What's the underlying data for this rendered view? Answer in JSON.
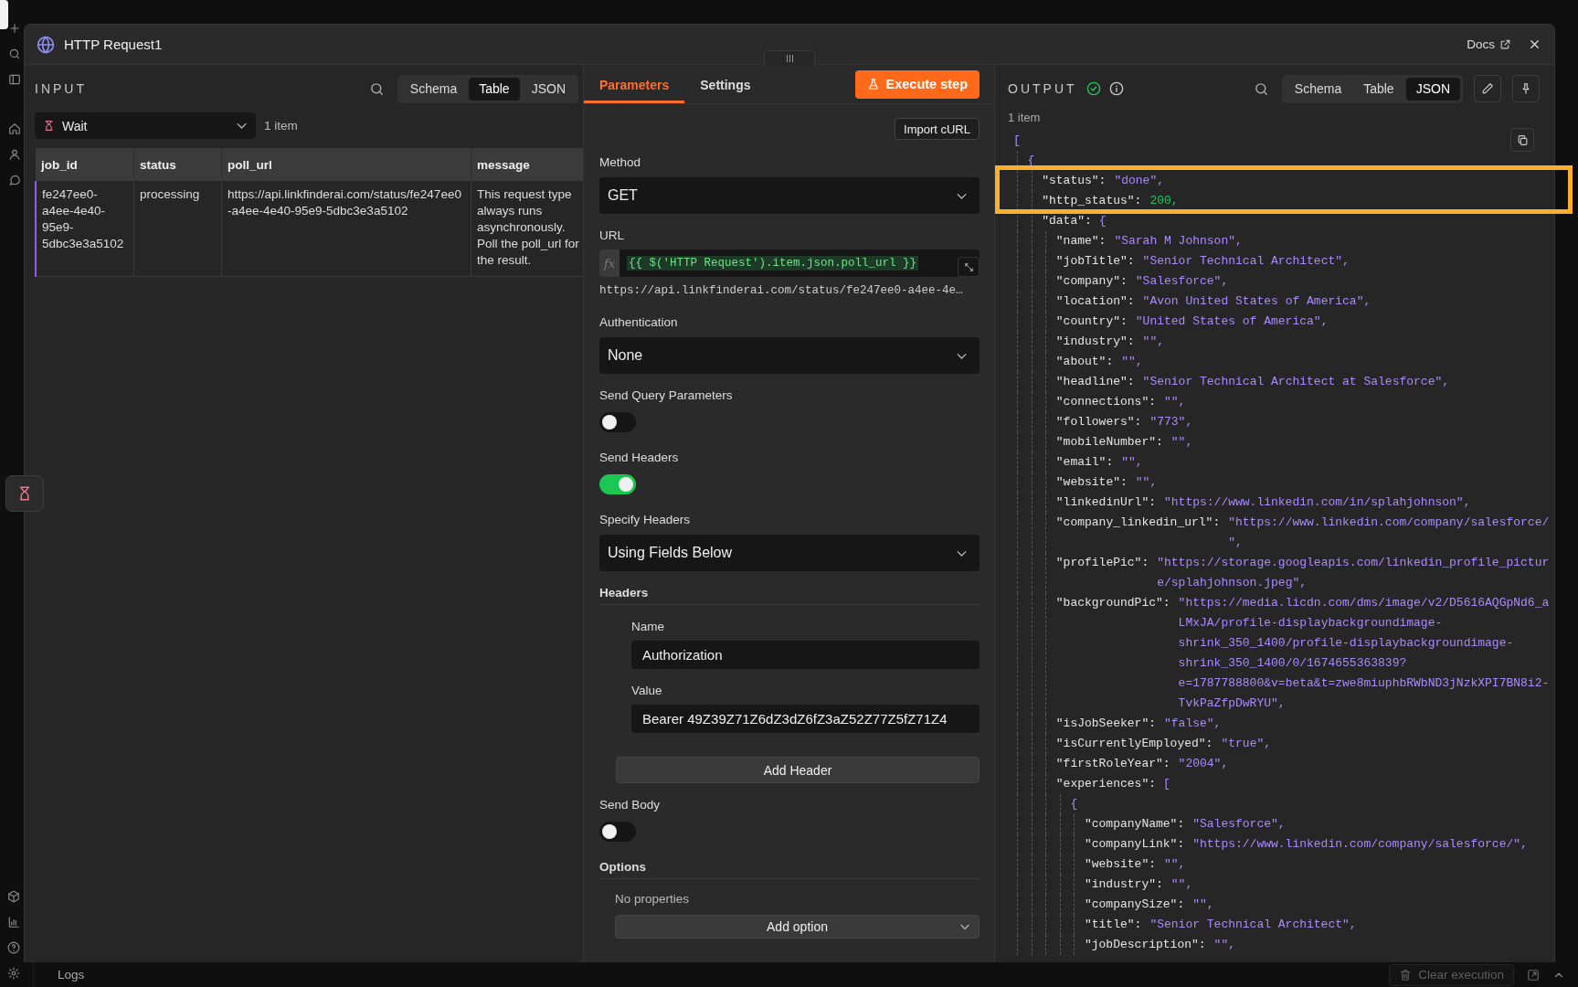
{
  "window": {
    "title": "HTTP Request1",
    "docs_link": "Docs"
  },
  "input": {
    "heading": "INPUT",
    "view_tabs": [
      {
        "label": "Schema",
        "selected": false
      },
      {
        "label": "Table",
        "selected": true
      },
      {
        "label": "JSON",
        "selected": false
      }
    ],
    "source": "Wait",
    "item_count": "1 item",
    "table": {
      "columns": [
        "job_id",
        "status",
        "poll_url",
        "message"
      ],
      "rows": [
        {
          "selected": true,
          "cells": [
            "fe247ee0-a4ee-4e40-95e9-5dbc3e3a5102",
            "processing",
            "https://api.linkfinderai.com/status/fe247ee0-a4ee-4e40-95e9-5dbc3e3a5102",
            "This request type always runs asynchronously. Poll the poll_url for the result."
          ]
        }
      ]
    }
  },
  "parameters": {
    "tabs": [
      {
        "label": "Parameters",
        "selected": true
      },
      {
        "label": "Settings",
        "selected": false
      }
    ],
    "execute_button": "Execute step",
    "import_button": "Import cURL",
    "fields": [
      {
        "kind": "select",
        "label": "Method",
        "value": "GET"
      },
      {
        "kind": "expression",
        "label": "URL",
        "fx": "fx",
        "value": "{{ $('HTTP Request').item.json.poll_url }}",
        "preview": "https://api.linkfinderai.com/status/fe247ee0-a4ee-4e…"
      },
      {
        "kind": "select",
        "label": "Authentication",
        "value": "None"
      },
      {
        "kind": "toggle",
        "label": "Send Query Parameters",
        "on": false
      },
      {
        "kind": "toggle",
        "label": "Send Headers",
        "on": true
      },
      {
        "kind": "select",
        "label": "Specify Headers",
        "value": "Using Fields Below"
      },
      {
        "kind": "collection",
        "label": "Headers",
        "entries": [
          {
            "label": "Name",
            "value": "Authorization"
          },
          {
            "label": "Value",
            "value": "Bearer 49Z39Z71Z6dZ3dZ6fZ3aZ52Z77Z5fZ71Z4"
          }
        ],
        "add_button": "Add Header"
      },
      {
        "kind": "toggle",
        "label": "Send Body",
        "on": false
      },
      {
        "kind": "options",
        "label": "Options",
        "empty_text": "No properties",
        "add_button": "Add option"
      }
    ]
  },
  "output": {
    "heading": "OUTPUT",
    "view_tabs": [
      {
        "label": "Schema",
        "selected": false
      },
      {
        "label": "Table",
        "selected": false
      },
      {
        "label": "JSON",
        "selected": true
      }
    ],
    "item_count": "1 item",
    "json": {
      "open": "[",
      "children": [
        {
          "open": "{",
          "children": [
            {
              "key": "\"status\":",
              "value": "\"done\",",
              "kind": "string",
              "highlighted": true
            },
            {
              "key": "\"http_status\":",
              "value": "200,",
              "kind": "number",
              "highlighted": true
            },
            {
              "key": "\"data\":",
              "open": "{",
              "children": [
                {
                  "key": "\"name\":",
                  "value": "\"Sarah M Johnson\",",
                  "kind": "string"
                },
                {
                  "key": "\"jobTitle\":",
                  "value": "\"Senior Technical Architect\",",
                  "kind": "string"
                },
                {
                  "key": "\"company\":",
                  "value": "\"Salesforce\",",
                  "kind": "string"
                },
                {
                  "key": "\"location\":",
                  "value": "\"Avon United States of America\",",
                  "kind": "string"
                },
                {
                  "key": "\"country\":",
                  "value": "\"United States of America\",",
                  "kind": "string"
                },
                {
                  "key": "\"industry\":",
                  "value": "\"\",",
                  "kind": "string"
                },
                {
                  "key": "\"about\":",
                  "value": "\"\",",
                  "kind": "string"
                },
                {
                  "key": "\"headline\":",
                  "value": "\"Senior Technical Architect at Salesforce\",",
                  "kind": "string"
                },
                {
                  "key": "\"connections\":",
                  "value": "\"\",",
                  "kind": "string"
                },
                {
                  "key": "\"followers\":",
                  "value": "\"773\",",
                  "kind": "string"
                },
                {
                  "key": "\"mobileNumber\":",
                  "value": "\"\",",
                  "kind": "string"
                },
                {
                  "key": "\"email\":",
                  "value": "\"\",",
                  "kind": "string"
                },
                {
                  "key": "\"website\":",
                  "value": "\"\",",
                  "kind": "string"
                },
                {
                  "key": "\"linkedinUrl\":",
                  "value": "\"https://www.linkedin.com/in/splahjohnson\",",
                  "kind": "string"
                },
                {
                  "key": "\"company_linkedin_url\":",
                  "value": "\"https://www.linkedin.com/company/salesforce/\",",
                  "kind": "string"
                },
                {
                  "key": "\"profilePic\":",
                  "value": "\"https://storage.googleapis.com/linkedin_profile_picture/splahjohnson.jpeg\",",
                  "kind": "string"
                },
                {
                  "key": "\"backgroundPic\":",
                  "value": "\"https://media.licdn.com/dms/image/v2/D5616AQGpNd6_aLMxJA/profile-displaybackgroundimage-shrink_350_1400/profile-displaybackgroundimage-shrink_350_1400/0/1674655363839?e=1787788800&v=beta&t=zwe8miuphbRWbND3jNzkXPI7BN8i2-TvkPaZfpDwRYU\",",
                  "kind": "string"
                },
                {
                  "key": "\"isJobSeeker\":",
                  "value": "\"false\",",
                  "kind": "string"
                },
                {
                  "key": "\"isCurrentlyEmployed\":",
                  "value": "\"true\",",
                  "kind": "string"
                },
                {
                  "key": "\"firstRoleYear\":",
                  "value": "\"2004\",",
                  "kind": "string"
                },
                {
                  "key": "\"experiences\":",
                  "open": "[",
                  "children": [
                    {
                      "open": "{",
                      "children": [
                        {
                          "key": "\"companyName\":",
                          "value": "\"Salesforce\",",
                          "kind": "string"
                        },
                        {
                          "key": "\"companyLink\":",
                          "value": "\"https://www.linkedin.com/company/salesforce/\",",
                          "kind": "string"
                        },
                        {
                          "key": "\"website\":",
                          "value": "\"\",",
                          "kind": "string"
                        },
                        {
                          "key": "\"industry\":",
                          "value": "\"\",",
                          "kind": "string"
                        },
                        {
                          "key": "\"companySize\":",
                          "value": "\"\",",
                          "kind": "string"
                        },
                        {
                          "key": "\"title\":",
                          "value": "\"Senior Technical Architect\",",
                          "kind": "string"
                        },
                        {
                          "key": "\"jobDescription\":",
                          "value": "\"\",",
                          "kind": "string"
                        }
                      ]
                    }
                  ]
                }
              ]
            }
          ]
        }
      ]
    }
  },
  "bottom_bar": {
    "logs_label": "Logs",
    "clear_button": {
      "label": "Clear execution",
      "disabled": true
    }
  }
}
